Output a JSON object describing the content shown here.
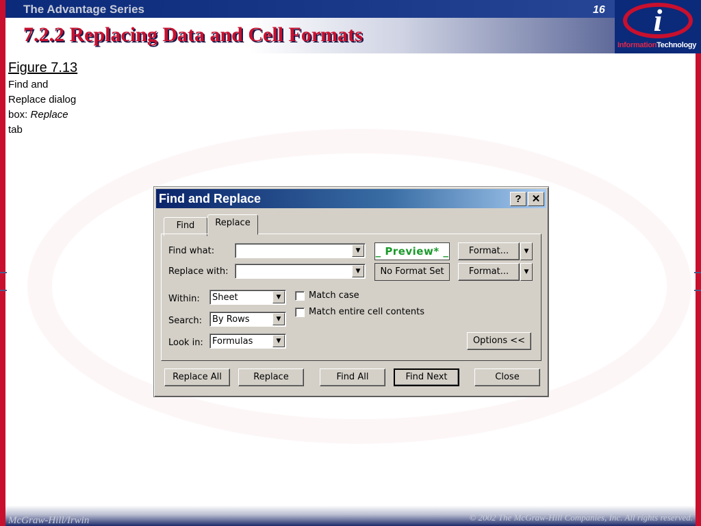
{
  "slide": {
    "series": "The Advantage Series",
    "page_number": "16",
    "title": "7.2.2 Replacing Data and Cell Formats",
    "logo": {
      "brand_red": "Information",
      "brand_white": "Technology"
    },
    "footer_left": "McGraw-Hill/Irwin",
    "footer_right": "© 2002  The McGraw-Hill Companies, Inc. All rights reserved."
  },
  "caption": {
    "title": "Figure 7.13",
    "line1": "Find and",
    "line2": "Replace dialog",
    "line3_prefix": "box: ",
    "line3_italic": "Replace",
    "line4": "tab"
  },
  "dialog": {
    "title": "Find and Replace",
    "help_button": "?",
    "close_button": "✕",
    "tabs": [
      {
        "label": "Find",
        "selected": false
      },
      {
        "label": "Replace",
        "selected": true
      }
    ],
    "find_what_label": "Find what:",
    "find_what_value": "",
    "replace_with_label": "Replace with:",
    "replace_with_value": "",
    "preview_label": "_  Preview*  _",
    "no_format_label": "No Format Set",
    "format_button_1": "Format...",
    "format_button_2": "Format...",
    "within_label": "Within:",
    "within_value": "Sheet",
    "search_label": "Search:",
    "search_value": "By Rows",
    "look_in_label": "Look in:",
    "look_in_value": "Formulas",
    "match_case_label": "Match case",
    "match_entire_label": "Match entire cell contents",
    "options_button": "Options <<",
    "buttons": {
      "replace_all": "Replace All",
      "replace": "Replace",
      "find_all": "Find All",
      "find_next": "Find Next",
      "close": "Close"
    },
    "dropdown_arrow": "▼"
  },
  "colors": {
    "accent_red": "#c8102e",
    "navy": "#0b2a7a",
    "dialog_face": "#d4d0c8",
    "preview_green": "#1a9a2a"
  }
}
